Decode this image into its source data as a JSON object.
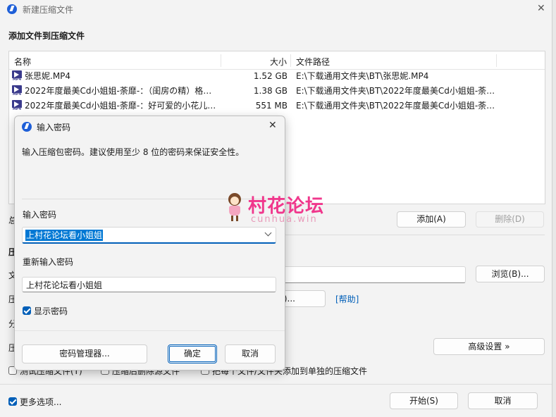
{
  "main_window": {
    "title": "新建压缩文件",
    "close_glyph": "✕",
    "section_title": "添加文件到压缩文件",
    "table": {
      "headers": [
        "名称",
        "大小",
        "文件路径"
      ],
      "rows": [
        {
          "icon": "mp4-file-icon",
          "name": "张思妮.MP4",
          "size": "1.52 GB",
          "path": "E:\\下载通用文件夹\\BT\\张思妮.MP4"
        },
        {
          "icon": "mp4-file-icon",
          "name": "2022年度最美Cd小姐姐-荼靡-：（闺房の精）格…",
          "size": "1.38 GB",
          "path": "E:\\下载通用文件夹\\BT\\2022年度最美Cd小姐姐-荼…"
        },
        {
          "icon": "mp4-file-icon",
          "name": "2022年度最美Cd小姐姐-荼靡-：好可爱的小花儿…",
          "size": "551 MB",
          "path": "E:\\下载通用文件夹\\BT\\2022年度最美Cd小姐姐-荼…"
        }
      ]
    },
    "add_button": "添加(A)",
    "delete_button": "删除(D)",
    "browse_button": "浏览(B)...",
    "help_link": "[帮助]",
    "partial_button": "P)...",
    "advanced_button": "高级设置 »",
    "checkbox_row": {
      "item1": "测试压缩文件(T)",
      "item2": "压缩后删除源文件",
      "item3": "把每个文件/文件夹添加到单独的压缩文件"
    },
    "more_options": {
      "label": "更多选项...",
      "checked": true
    },
    "start_button": "开始(S)",
    "cancel_button": "取消",
    "left_fragments": [
      "总",
      "压",
      "文",
      "压",
      "分",
      "压"
    ]
  },
  "password_dialog": {
    "title": "输入密码",
    "close_glyph": "✕",
    "description": "输入压缩包密码。建议使用至少 8 位的密码来保证安全性。",
    "password_label": "输入密码",
    "password_value": "上村花论坛看小姐姐",
    "confirm_label": "重新输入密码",
    "confirm_value": "上村花论坛看小姐姐",
    "show_password": {
      "label": "显示密码",
      "checked": true
    },
    "manager_button": "密码管理器...",
    "ok_button": "确定",
    "cancel_button": "取消"
  },
  "watermark": {
    "text": "村花论坛",
    "subtext": "cunhua.win",
    "color": "#f0378c"
  },
  "colors": {
    "accent": "#005fb8",
    "selection": "#0078d4"
  }
}
